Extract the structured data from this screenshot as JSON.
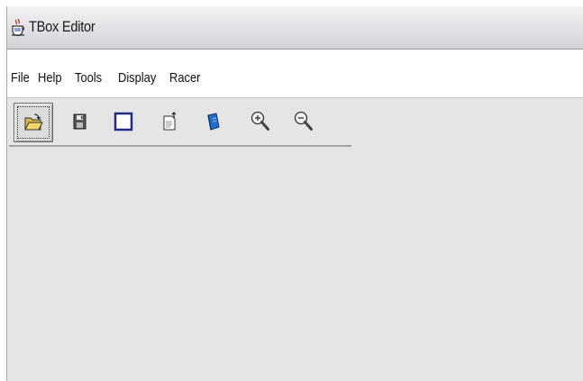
{
  "window": {
    "title": "TBox Editor"
  },
  "menubar": {
    "items": [
      {
        "label": "File"
      },
      {
        "label": "Help"
      },
      {
        "label": "Tools"
      },
      {
        "label": "Display"
      },
      {
        "label": "Racer"
      }
    ]
  },
  "toolbar": {
    "buttons": [
      {
        "icon": "open-folder-icon",
        "selected": true
      },
      {
        "icon": "save-disk-icon"
      },
      {
        "icon": "blank-square-icon"
      },
      {
        "icon": "document-export-icon"
      },
      {
        "icon": "blue-book-icon"
      },
      {
        "icon": "zoom-in-icon"
      },
      {
        "icon": "zoom-out-icon"
      }
    ]
  },
  "colors": {
    "window_background": "#e6e5e5",
    "menubar_background": "#ffffff",
    "titlebar_gradient_top": "#f4f4f5",
    "titlebar_gradient_bottom": "#d1d1d8"
  }
}
